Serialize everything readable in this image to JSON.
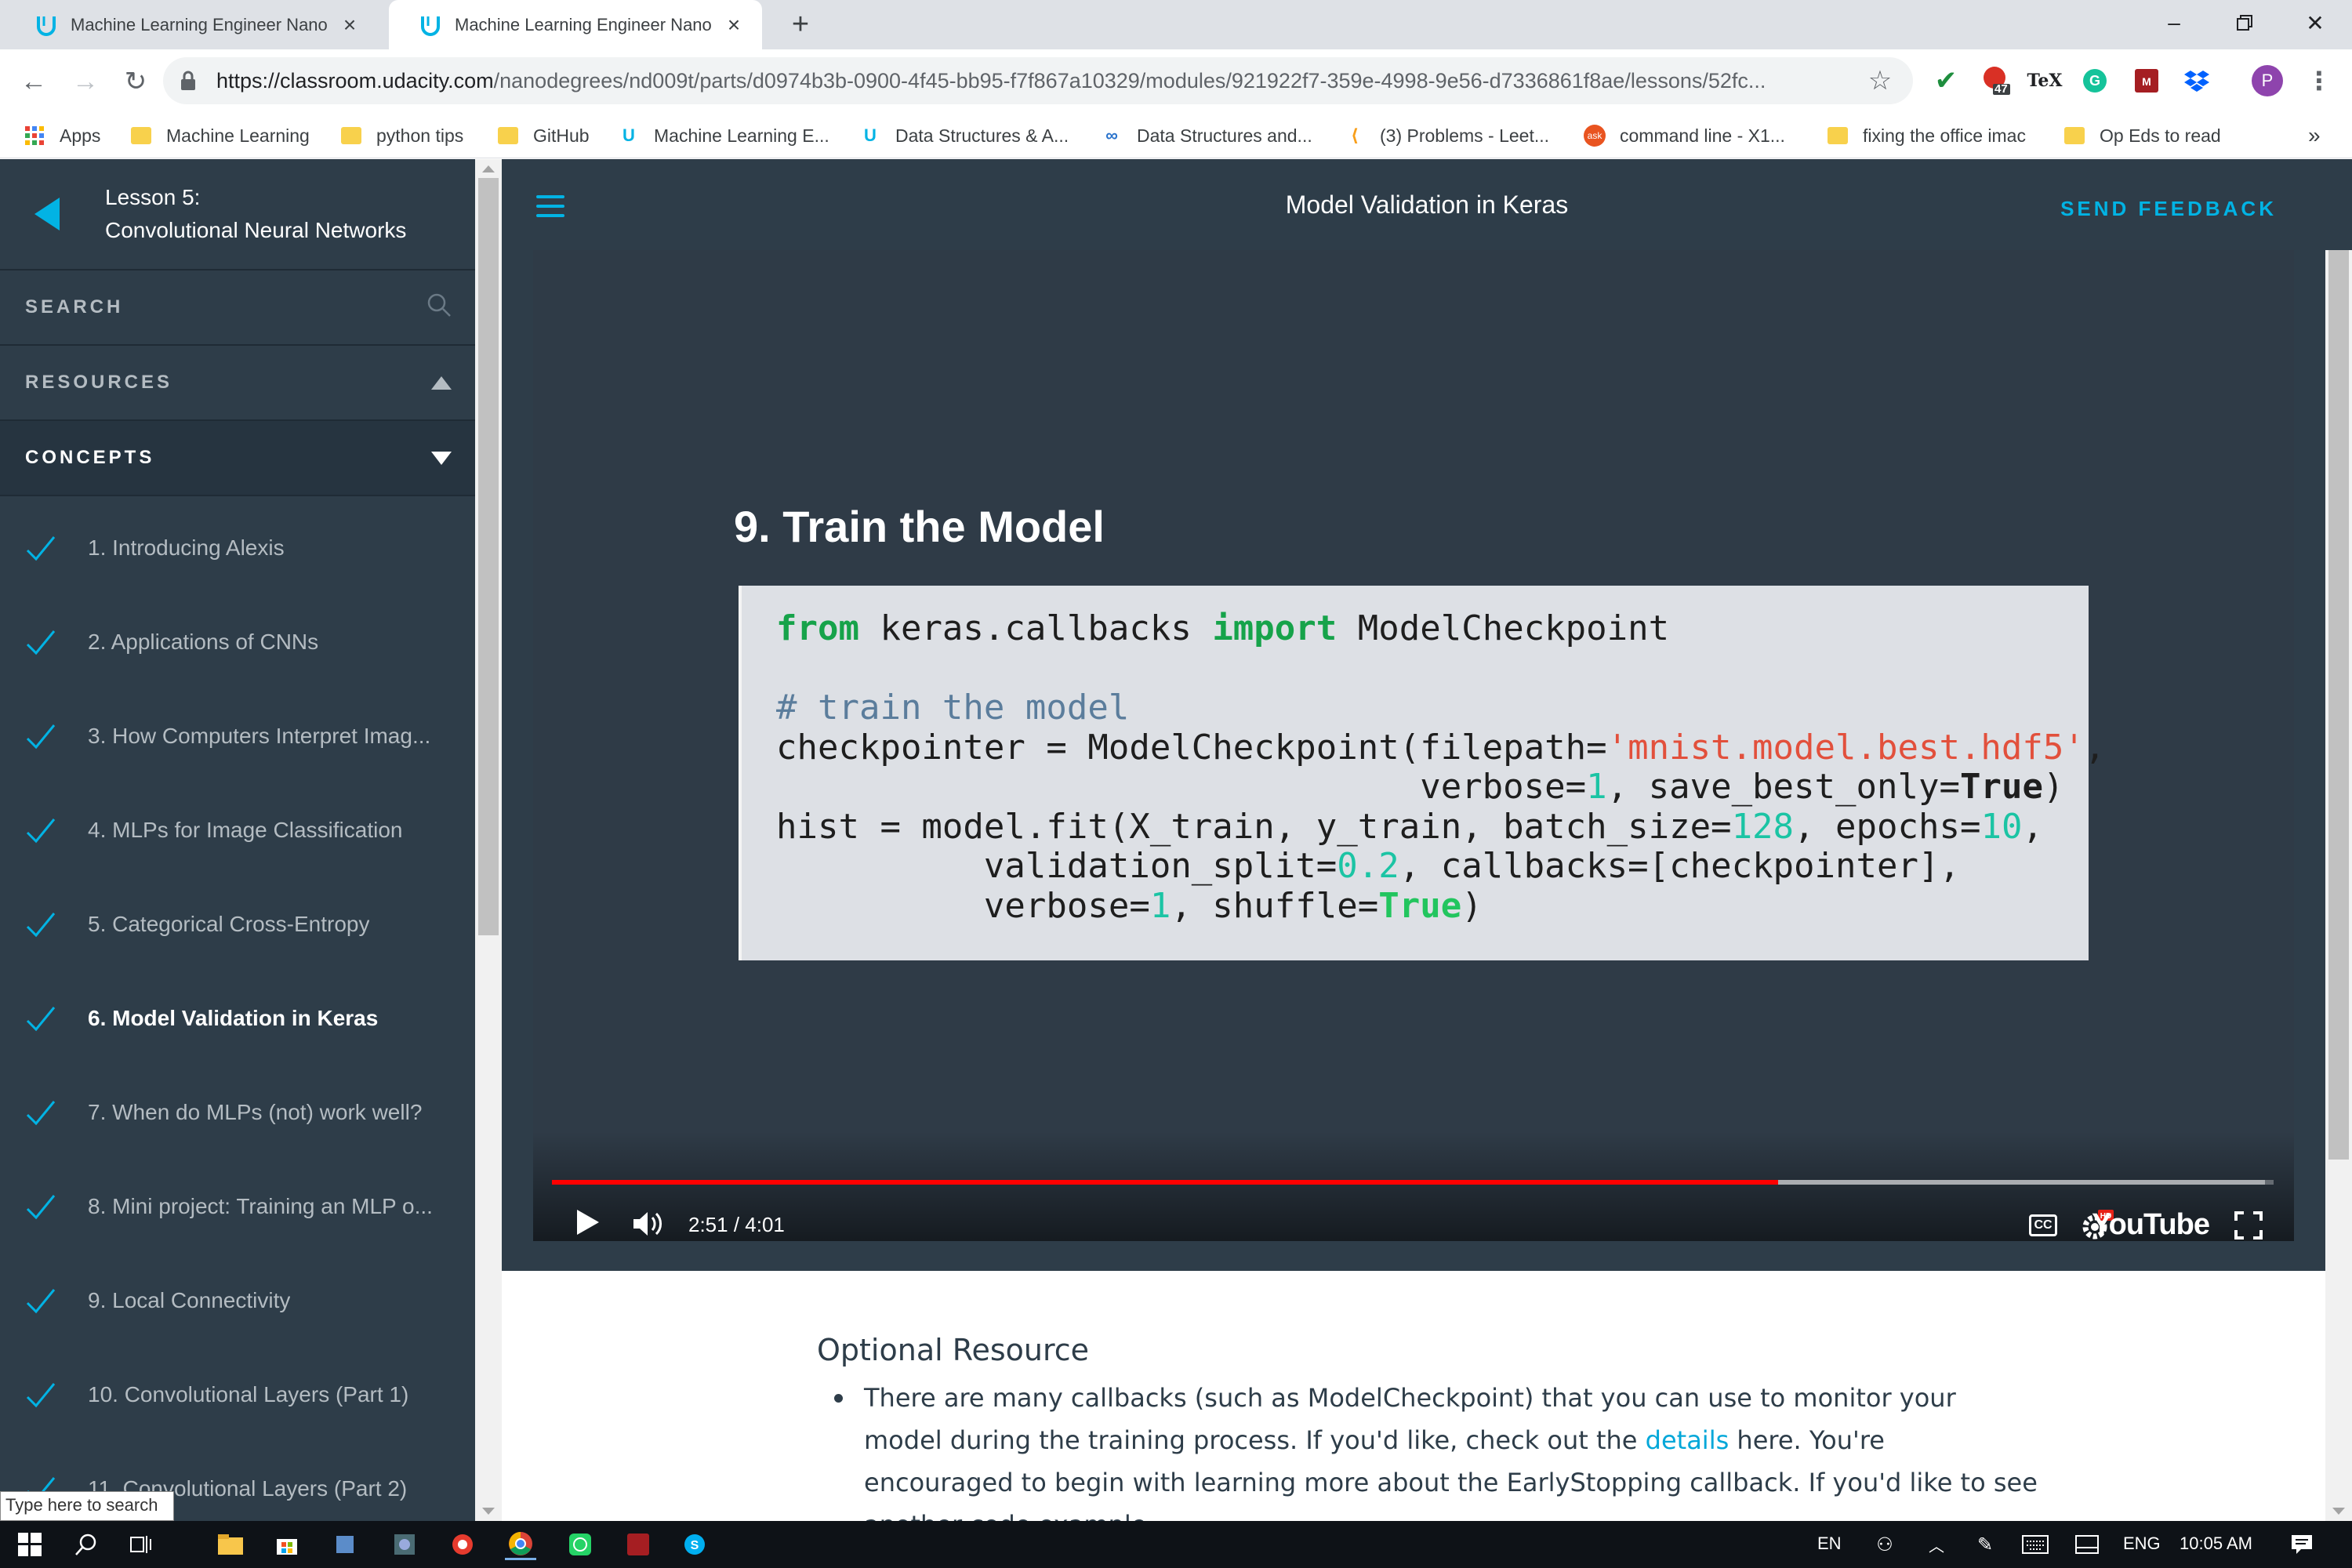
{
  "browser": {
    "tabs": [
      {
        "title": "Machine Learning Engineer Nano",
        "active": false
      },
      {
        "title": "Machine Learning Engineer Nano",
        "active": true
      }
    ],
    "url_host": "https://classroom.udacity.com",
    "url_path": "/nanodegrees/nd009t/parts/d0974b3b-0900-4f45-bb95-f7f867a10329/modules/921922f7-359e-4998-9e56-d7336861f8ae/lessons/52fc...",
    "extension_badge": "47",
    "profile_initial": "P",
    "bookmarks": [
      {
        "label": "Apps"
      },
      {
        "label": "Machine Learning"
      },
      {
        "label": "python tips"
      },
      {
        "label": "GitHub"
      },
      {
        "label": "Machine Learning E..."
      },
      {
        "label": "Data Structures & A..."
      },
      {
        "label": "Data Structures and..."
      },
      {
        "label": "(3) Problems - Leet..."
      },
      {
        "label": "command line - X1..."
      },
      {
        "label": "fixing the office imac"
      },
      {
        "label": "Op Eds to read"
      }
    ],
    "bookmarks_overflow": "»"
  },
  "sidebar": {
    "lesson_number": "Lesson 5:",
    "lesson_title": "Convolutional Neural Networks",
    "search_label": "SEARCH",
    "resources_label": "RESOURCES",
    "concepts_label": "CONCEPTS",
    "concepts": [
      {
        "label": "1. Introducing Alexis",
        "active": false
      },
      {
        "label": "2. Applications of CNNs",
        "active": false
      },
      {
        "label": "3. How Computers Interpret Imag...",
        "active": false
      },
      {
        "label": "4. MLPs for Image Classification",
        "active": false
      },
      {
        "label": "5. Categorical Cross-Entropy",
        "active": false
      },
      {
        "label": "6. Model Validation in Keras",
        "active": true
      },
      {
        "label": "7. When do MLPs (not) work well?",
        "active": false
      },
      {
        "label": "8. Mini project: Training an MLP o...",
        "active": false
      },
      {
        "label": "9. Local Connectivity",
        "active": false
      },
      {
        "label": "10. Convolutional Layers (Part 1)",
        "active": false
      },
      {
        "label": "11. Convolutional Layers (Part 2)",
        "active": false
      }
    ],
    "search_tooltip": "Type here to search"
  },
  "header": {
    "title": "Model Validation in Keras",
    "feedback": "SEND FEEDBACK"
  },
  "video": {
    "slide_title": "9. Train the Model",
    "time": "2:51 / 4:01",
    "progress_played": 0.712,
    "progress_loaded": 0.995,
    "cc": "CC",
    "hd_badge": "HD",
    "brand": "YouTube"
  },
  "content": {
    "heading": "Optional Resource",
    "bullet_before": "There are many callbacks (such as ModelCheckpoint) that you can use to monitor your model during the training process. If you'd like, check out the ",
    "bullet_link": "details",
    "bullet_after": " here. You're encouraged to begin with learning more about the EarlyStopping callback. If you'd like to see another code example"
  },
  "taskbar": {
    "lang_short": "EN",
    "lang_long": "ENG",
    "clock": "10:05 AM"
  },
  "colors": {
    "udacity_blue": "#02b3e4",
    "sidebar_bg": "#2e3d49",
    "progress_red": "#ff0000"
  }
}
